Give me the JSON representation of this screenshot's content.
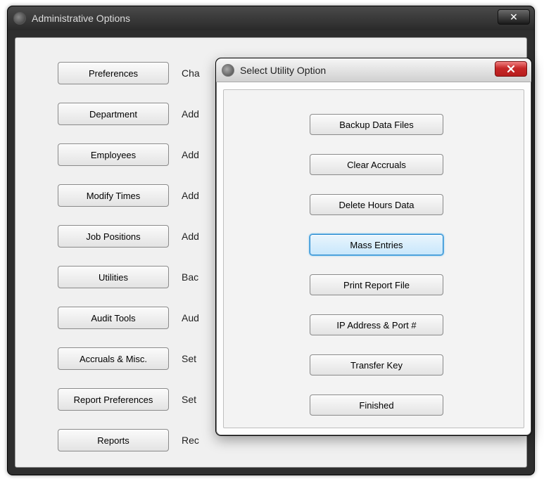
{
  "main_window": {
    "title": "Administrative Options",
    "close_glyph": "✕",
    "items": [
      {
        "label": "Preferences",
        "desc": "Cha"
      },
      {
        "label": "Department",
        "desc": "Add"
      },
      {
        "label": "Employees",
        "desc": "Add"
      },
      {
        "label": "Modify Times",
        "desc": "Add"
      },
      {
        "label": "Job Positions",
        "desc": "Add"
      },
      {
        "label": "Utilities",
        "desc": "Bac"
      },
      {
        "label": "Audit Tools",
        "desc": "Aud"
      },
      {
        "label": "Accruals & Misc.",
        "desc": "Set"
      },
      {
        "label": "Report Preferences",
        "desc": "Set"
      },
      {
        "label": "Reports",
        "desc": "Rec"
      }
    ]
  },
  "dialog": {
    "title": "Select Utility Option",
    "buttons": {
      "backup": "Backup Data Files",
      "clear": "Clear Accruals",
      "delete": "Delete Hours Data",
      "mass": "Mass Entries",
      "print": "Print Report File",
      "ip": "IP Address & Port #",
      "transfer": "Transfer Key",
      "finished": "Finished"
    }
  }
}
